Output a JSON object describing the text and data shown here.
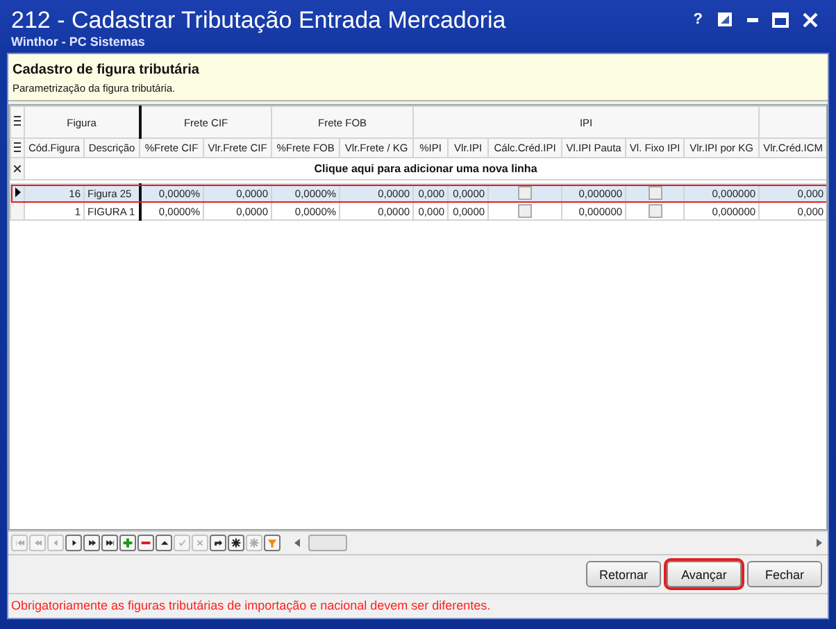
{
  "window": {
    "title": "212 - Cadastrar Tributação Entrada Mercadoria",
    "subtitle": "Winthor - PC Sistemas",
    "help": "?"
  },
  "header": {
    "title": "Cadastro de figura tributária",
    "subtitle": "Parametrização da figura tributária."
  },
  "grid": {
    "groups": [
      "Figura",
      "Frete CIF",
      "Frete FOB",
      "IPI"
    ],
    "columns": [
      "Cód.Figura",
      "Descrição",
      "%Frete CIF",
      "Vlr.Frete CIF",
      "%Frete FOB",
      "Vlr.Frete / KG",
      "%IPI",
      "Vlr.IPI",
      "Cálc.Créd.IPI",
      "Vl.IPI Pauta",
      "Vl. Fixo IPI",
      "Vlr.IPI por KG",
      "Vlr.Créd.ICM"
    ],
    "new_row": "Clique aqui para adicionar uma nova linha",
    "rows": [
      {
        "selected": true,
        "cells": [
          "16",
          "Figura 25",
          "0,0000%",
          "0,0000",
          "0,0000%",
          "0,0000",
          "0,000",
          "0,0000",
          false,
          "0,000000",
          false,
          "0,000000",
          "0,000"
        ]
      },
      {
        "selected": false,
        "cells": [
          "1",
          "FIGURA 1",
          "0,0000%",
          "0,0000",
          "0,0000%",
          "0,0000",
          "0,000",
          "0,0000",
          false,
          "0,000000",
          false,
          "0,000000",
          "0,000"
        ]
      }
    ]
  },
  "navigator": [
    {
      "kind": "first",
      "disabled": true
    },
    {
      "kind": "prior-page",
      "disabled": true
    },
    {
      "kind": "prior",
      "disabled": true
    },
    {
      "kind": "next",
      "disabled": false
    },
    {
      "kind": "next-page",
      "disabled": false
    },
    {
      "kind": "last",
      "disabled": false
    },
    {
      "kind": "insert",
      "disabled": false
    },
    {
      "kind": "delete",
      "disabled": false
    },
    {
      "kind": "edit",
      "disabled": false
    },
    {
      "kind": "post",
      "disabled": true
    },
    {
      "kind": "cancel",
      "disabled": true
    },
    {
      "kind": "refresh",
      "disabled": false
    },
    {
      "kind": "bookmark",
      "disabled": false
    },
    {
      "kind": "goto",
      "disabled": true
    },
    {
      "kind": "filter",
      "disabled": false
    }
  ],
  "buttons": [
    {
      "label": "Retornar",
      "focused": false
    },
    {
      "label": "Avançar",
      "focused": true
    },
    {
      "label": "Fechar",
      "focused": false
    }
  ],
  "error": "Obrigatoriamente as figuras tributárias de importação e nacional devem ser diferentes."
}
